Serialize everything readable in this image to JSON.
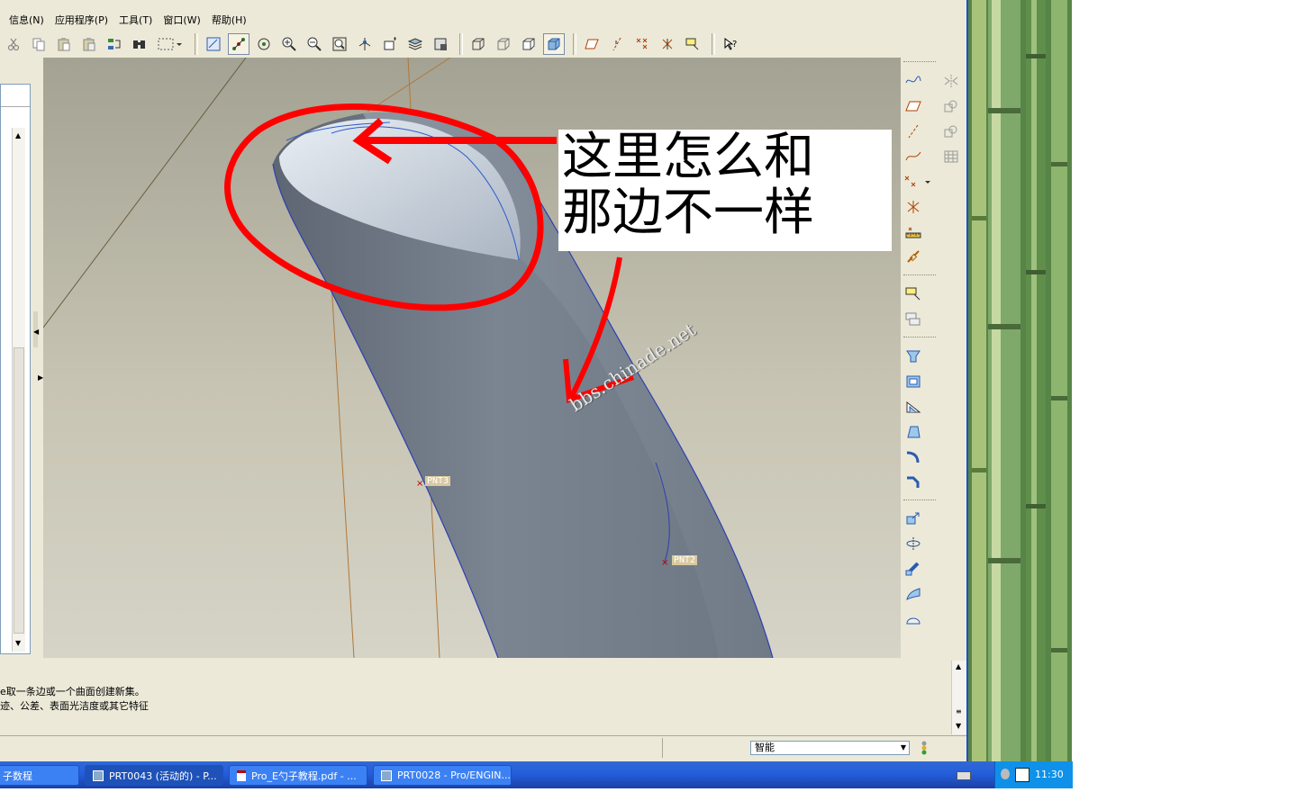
{
  "menubar": {
    "items": [
      "信息(N)",
      "应用程序(P)",
      "工具(T)",
      "窗口(W)",
      "帮助(H)"
    ]
  },
  "viewport": {
    "annotation_text_line1": "这里怎么和",
    "annotation_text_line2": "那边不一样",
    "watermark": "bbs.chinade.net",
    "point_label_1": "PNT3",
    "point_label_2": "PNT2"
  },
  "messages": {
    "line1": "e取一条边或一个曲面创建新集。",
    "line2": "迹、公差、表面光洁度或其它特征"
  },
  "status_bar": {
    "filter_value": "智能"
  },
  "taskbar": {
    "items": [
      {
        "label": "子数程"
      },
      {
        "label": "PRT0043 (活动的) - P..."
      },
      {
        "label": "Pro_E勺子教程.pdf - ..."
      },
      {
        "label": "PRT0028 - Pro/ENGIN..."
      }
    ],
    "clock": "11:30"
  },
  "colors": {
    "annotation_red": "#ff0000",
    "taskbar_blue": "#245edb",
    "model_gray": "#7a8592"
  }
}
